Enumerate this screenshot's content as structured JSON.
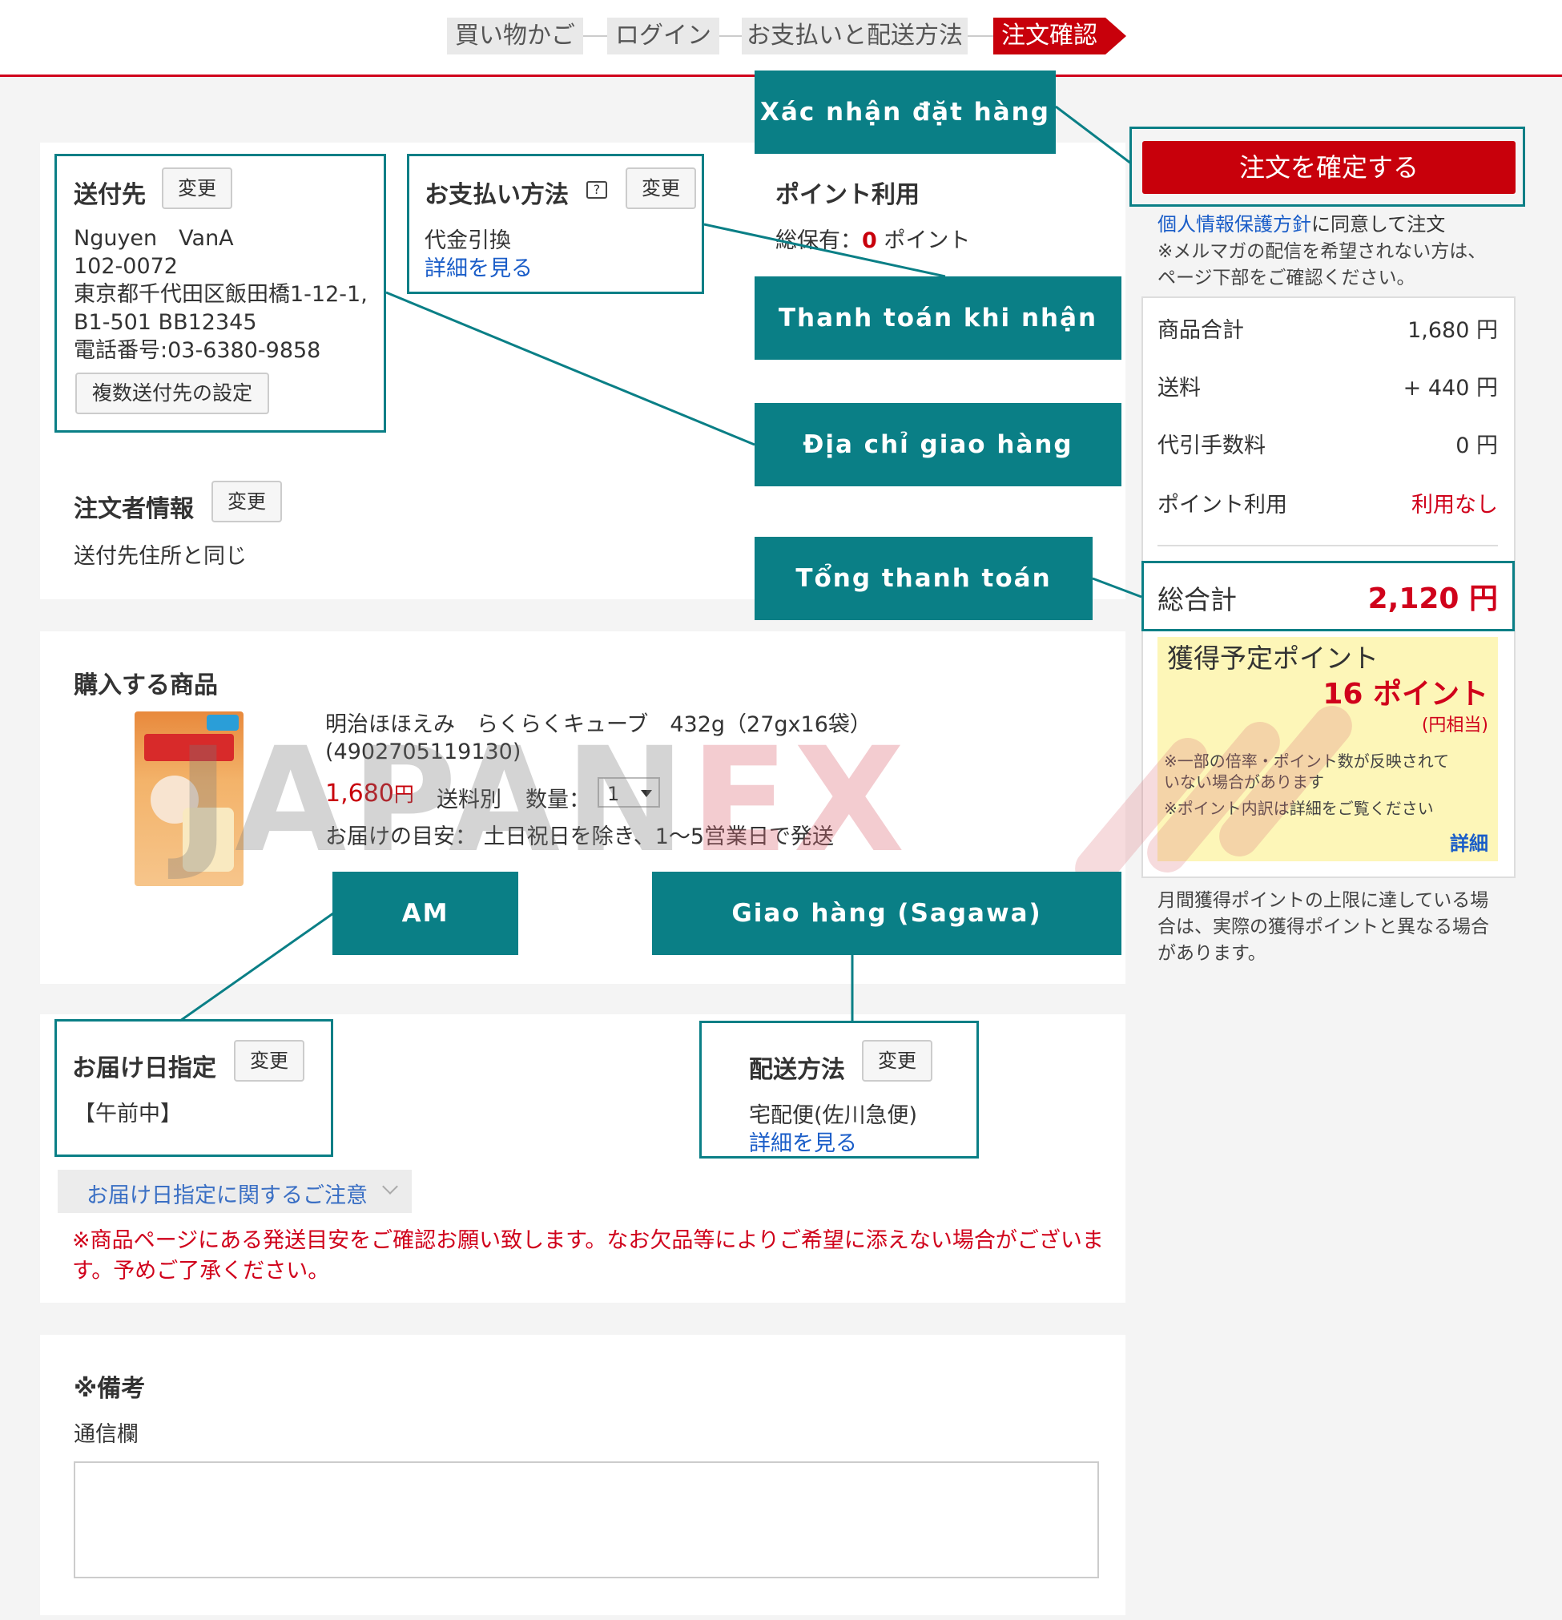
{
  "steps": {
    "cart": "買い物かご",
    "login": "ログイン",
    "payment_shipping": "お支払いと配送方法",
    "confirm": "注文確認"
  },
  "shipping_to": {
    "title": "送付先",
    "change": "変更",
    "name": "Nguyen　VanA",
    "postal": "102-0072",
    "address1": "東京都千代田区飯田橋1-12-1,",
    "address2": "B1-501 BB12345",
    "phone": "電話番号:03-6380-9858",
    "multi_button": "複数送付先の設定"
  },
  "payment": {
    "title": "お支払い方法",
    "help_icon": "?",
    "change": "変更",
    "method": "代金引換",
    "details": "詳細を見る"
  },
  "points": {
    "title": "ポイント利用",
    "held_prefix": "総保有：",
    "held_value": "0",
    "held_suffix": " ポイント"
  },
  "orderer": {
    "title": "注文者情報",
    "change": "変更",
    "value": "送付先住所と同じ"
  },
  "products": {
    "title": "購入する商品",
    "name": "明治ほほえみ　らくらくキューブ　432g（27gx16袋）",
    "code": "(4902705119130)",
    "price": "1,680",
    "price_unit": "円",
    "shipping_note": "送料別",
    "qty_label": "数量：",
    "qty_value": "1",
    "delivery_estimate": "お届けの目安：  土日祝日を除き、1〜5営業日で発送"
  },
  "delivery_date": {
    "title": "お届け日指定",
    "change": "変更",
    "value": "【午前中】",
    "notice_toggle": "お届け日指定に関するご注意",
    "warning": "※商品ページにある発送目安をご確認お願い致します。なお欠品等によりご希望に添えない場合がございます。予めご了承ください。"
  },
  "shipping_method": {
    "title": "配送方法",
    "change": "変更",
    "value": "宅配便(佐川急便)",
    "details": "詳細を見る"
  },
  "remarks": {
    "title": "※備考",
    "label": "通信欄",
    "value": ""
  },
  "sidebar": {
    "confirm_button": "注文を確定する",
    "privacy_link": "個人情報保護方針",
    "privacy_suffix": "に同意して注文",
    "mail_note": "※メルマガの配信を希望されない方は、ページ下部をご確認ください。",
    "rows": [
      {
        "label": "商品合計",
        "value": "1,680 円"
      },
      {
        "label": "送料",
        "value": "+ 440 円"
      },
      {
        "label": "代引手数料",
        "value": "0 円"
      },
      {
        "label": "ポイント利用",
        "value": "利用なし"
      }
    ],
    "total_label": "総合計",
    "total_value": "2,120 円",
    "points_label": "獲得予定ポイント",
    "points_value": "16 ポイント",
    "points_yen": "(円相当)",
    "points_note1": "※一部の倍率・ポイント数が反映されていない場合があります",
    "points_note2": "※ポイント内訳は詳細をご覧ください",
    "points_details": "詳細",
    "limit_note": "月間獲得ポイントの上限に達している場合は、実際の獲得ポイントと異なる場合があります。"
  },
  "callouts": {
    "confirm": "Xác nhận đặt hàng",
    "cod": "Thanh toán khi nhận hàng",
    "address": "Địa chỉ giao hàng",
    "total": "Tổng thanh toán",
    "am": "AM",
    "delivery": "Giao hàng (Sagawa)"
  },
  "watermark": {
    "part1": "JAPAN",
    "part2": "EX"
  },
  "colors": {
    "accent": "#c8000b",
    "teal": "#0a7f86",
    "link": "#1a5dc8"
  }
}
